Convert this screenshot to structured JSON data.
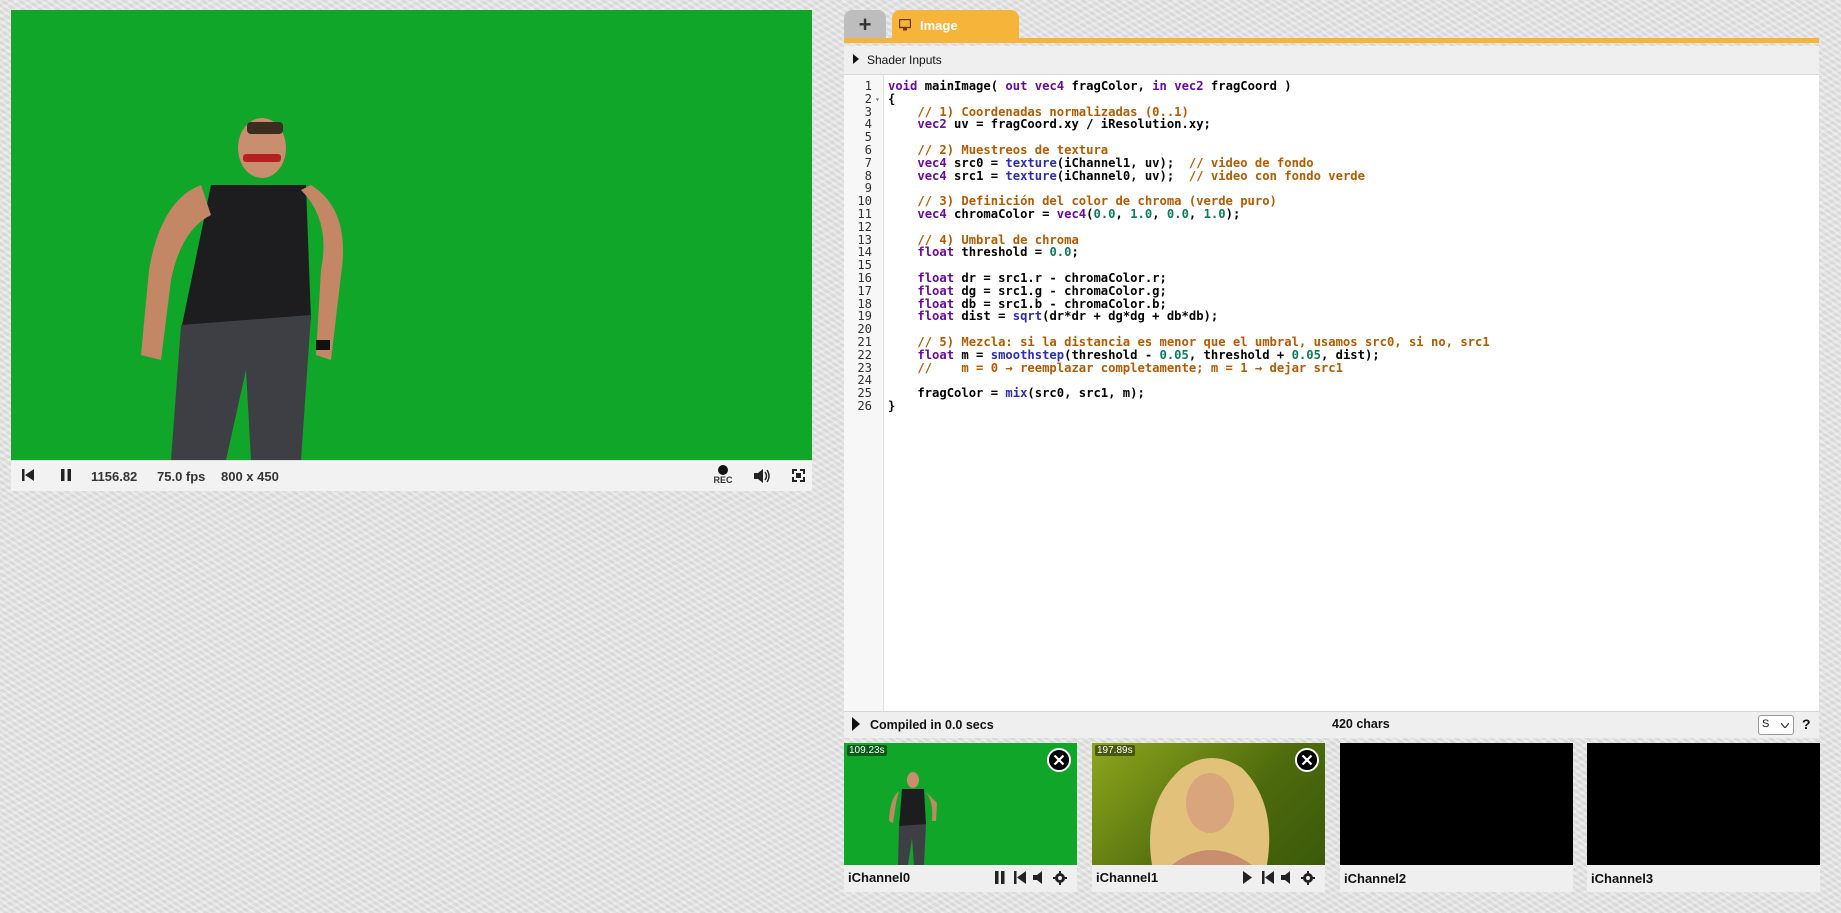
{
  "player": {
    "time": "1156.82",
    "fps": "75.0 fps",
    "resolution": "800 x 450",
    "rec_label": "REC"
  },
  "editor": {
    "add_tab": "+",
    "active_tab": "Image",
    "shader_inputs_label": "Shader Inputs",
    "status": "Compiled in 0.0 secs",
    "char_count": "420 chars",
    "font_select_value": "S",
    "help": "?"
  },
  "code": {
    "lines": [
      "void mainImage( out vec4 fragColor, in vec2 fragCoord )",
      "{",
      "    // 1) Coordenadas normalizadas (0..1)",
      "    vec2 uv = fragCoord.xy / iResolution.xy;",
      "",
      "    // 2) Muestreos de textura",
      "    vec4 src0 = texture(iChannel1, uv);  // video de fondo",
      "    vec4 src1 = texture(iChannel0, uv);  // video con fondo verde",
      "",
      "    // 3) Definición del color de chroma (verde puro)",
      "    vec4 chromaColor = vec4(0.0, 1.0, 0.0, 1.0);",
      "",
      "    // 4) Umbral de chroma",
      "    float threshold = 0.0;",
      "",
      "    float dr = src1.r - chromaColor.r;",
      "    float dg = src1.g - chromaColor.g;",
      "    float db = src1.b - chromaColor.b;",
      "    float dist = sqrt(dr*dr + dg*dg + db*db);",
      "",
      "    // 5) Mezcla: si la distancia es menor que el umbral, usamos src0, si no, src1",
      "    float m = smoothstep(threshold - 0.05, threshold + 0.05, dist);",
      "    //    m = 0 → reemplazar completamente; m = 1 → dejar src1",
      "",
      "    fragColor = mix(src0, src1, m);",
      "}"
    ]
  },
  "channels": [
    {
      "label": "iChannel0",
      "time": "109.23s"
    },
    {
      "label": "iChannel1",
      "time": "197.89s"
    },
    {
      "label": "iChannel2"
    },
    {
      "label": "iChannel3"
    }
  ],
  "colors": {
    "chroma_green": "#10a62a",
    "tab_accent": "#f6b53a"
  }
}
